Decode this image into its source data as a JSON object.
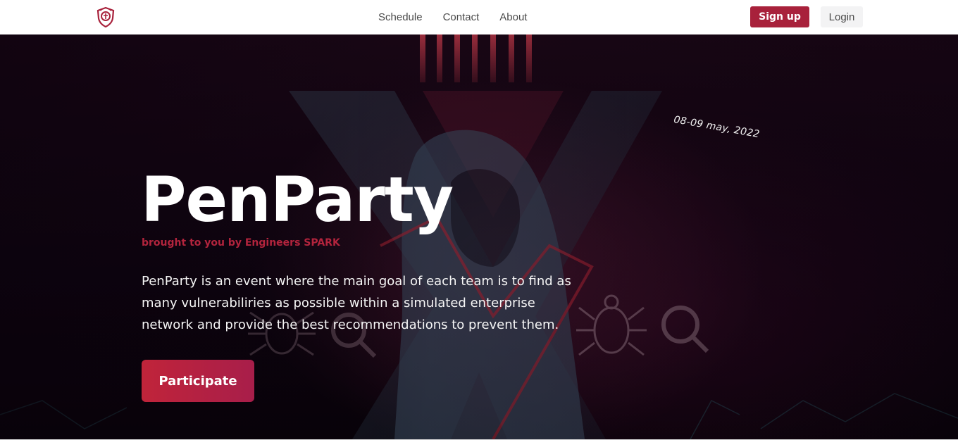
{
  "navbar": {
    "logo_icon": "shield-logo-icon",
    "links": [
      "Schedule",
      "Contact",
      "About"
    ],
    "signup_label": "Sign up",
    "login_label": "Login"
  },
  "hero": {
    "date": "08-09 may, 2022",
    "title": "PenParty",
    "subtitle": "brought to you by Engineers SPARK",
    "description": "PenParty is an event where the main goal of each team is to find as many vulnerabiliries as possible within a simulated enterprise network and provide the best recommendations to prevent them.",
    "cta_label": "Participate"
  },
  "colors": {
    "brand": "#a8213b",
    "subtitle": "#b3243d",
    "cta_start": "#c0243a",
    "cta_end": "#a81e4a",
    "hero_bg": "#0f0410"
  }
}
